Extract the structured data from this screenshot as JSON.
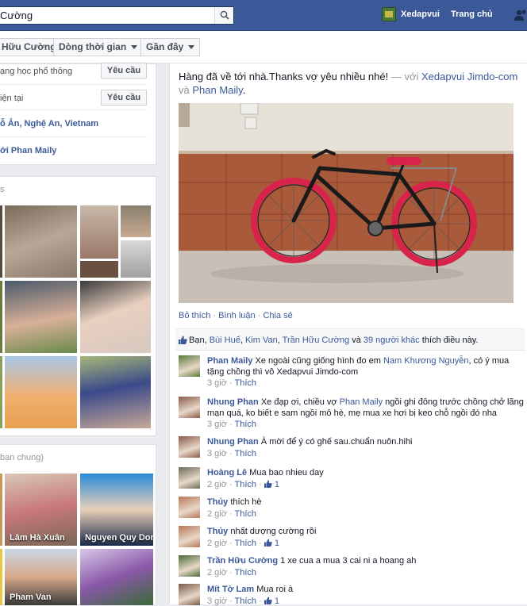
{
  "topbar": {
    "search_value": "Cường",
    "user_name": "Xedapvui",
    "home_label": "Trang chủ"
  },
  "subnav": {
    "profile_name": "Hữu Cường",
    "timeline_label": "Dòng thời gian",
    "recent_label": "Gần đây"
  },
  "about": {
    "high_school": "ạng học phổ thông",
    "current_city": "iện tại",
    "request_label": "Yêu cầu",
    "hometown": "ỗ Ản, Nghệ An, Vietnam",
    "relationship": "ới Phan Maily"
  },
  "photos": {
    "header": "s"
  },
  "friends": {
    "header": "bạn chung)",
    "names": [
      "Lâm Hà Xuân",
      "Nguyen Quy Don",
      "Pham Van"
    ]
  },
  "post": {
    "text_main": "Hàng đã về tới nhà.Thanks vợ yêu nhiều nhé!",
    "text_with": " — với ",
    "tag1": "Xedapvui Jimdo-com",
    "text_and": " và ",
    "tag2": "Phan Maily",
    "text_end": ".",
    "actions": {
      "like": "Bỏ thích",
      "comment": "Bình luận",
      "share": "Chia sẻ"
    },
    "likes": {
      "prefix": "Bạn, ",
      "names": [
        "Bùi Huế",
        "Kim Van",
        "Trần Hữu Cường"
      ],
      "and": " và ",
      "others": "39 người khác",
      "suffix": " thích điều này."
    }
  },
  "comments": [
    {
      "name": "Phan Maily",
      "text_a": " Xe ngoài cũng giống hình đo em ",
      "mention": "Nam Khương Nguyễn",
      "text_b": ", có ý mua tặng chồng thì vô Xedapvui Jimdo-com",
      "time": "3 giờ",
      "like": "Thích",
      "count": ""
    },
    {
      "name": "Nhung Phan",
      "text_a": " Xe đạp ơi, chiều vợ ",
      "mention": "Phan Maily",
      "text_b": " ngồi ghi đông trước chồng chở lãng mạn quá, ko biết e sam ngồi mô hè, mẹ mua xe hơi bị keo chỗ ngồi đó nha",
      "time": "3 giờ",
      "like": "Thích",
      "count": ""
    },
    {
      "name": "Nhung Phan",
      "text_a": " À mời để ý có ghế sau.chuẩn nuôn.hihi",
      "mention": "",
      "text_b": "",
      "time": "3 giờ",
      "like": "Thích",
      "count": ""
    },
    {
      "name": "Hoàng Lê",
      "text_a": " Mua bao nhieu day",
      "mention": "",
      "text_b": "",
      "time": "2 giờ",
      "like": "Thích",
      "count": "1"
    },
    {
      "name": "Thủy",
      "text_a": " thích hè",
      "mention": "",
      "text_b": "",
      "time": "2 giờ",
      "like": "Thích",
      "count": ""
    },
    {
      "name": "Thủy",
      "text_a": " nhất dượng cường rồi",
      "mention": "",
      "text_b": "",
      "time": "2 giờ",
      "like": "Thích",
      "count": "1"
    },
    {
      "name": "Trần Hữu Cường",
      "text_a": " 1 xe cua a mua 3 cai ni a hoang ah",
      "mention": "",
      "text_b": "",
      "time": "2 giờ",
      "like": "Thích",
      "count": ""
    },
    {
      "name": "Mít Tờ Lam",
      "text_a": " Mua roi à",
      "mention": "",
      "text_b": "",
      "time": "3 giờ",
      "like": "Thích",
      "count": "1"
    }
  ],
  "colors": {
    "brand": "#3b5998",
    "link": "#3b5998",
    "page_bg": "#e9ebee"
  }
}
